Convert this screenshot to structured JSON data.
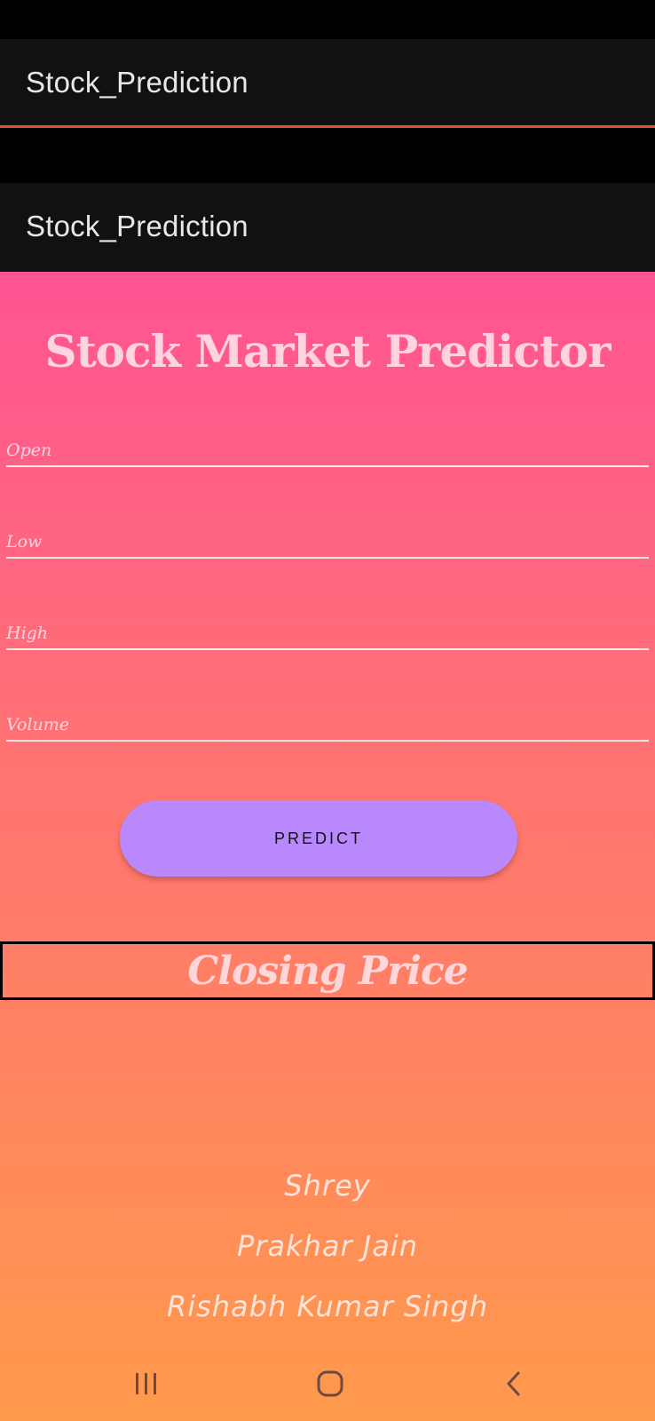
{
  "app_bars": [
    {
      "title": "Stock_Prediction"
    },
    {
      "title": "Stock_Prediction"
    }
  ],
  "main": {
    "headline": "Stock Market Predictor",
    "fields": [
      {
        "name": "open",
        "placeholder": "Open",
        "value": ""
      },
      {
        "name": "low",
        "placeholder": "Low",
        "value": ""
      },
      {
        "name": "high",
        "placeholder": "High",
        "value": ""
      },
      {
        "name": "volume",
        "placeholder": "Volume",
        "value": ""
      }
    ],
    "predict_label": "PREDICT",
    "result_label": "Closing Price",
    "credits": [
      "Shrey",
      "Prakhar Jain",
      "Rishabh Kumar Singh"
    ]
  },
  "nav": {
    "recent": "recent-apps-icon",
    "home": "home-icon",
    "back": "back-icon"
  },
  "colors": {
    "gradient_top": "#ff5494",
    "gradient_bottom": "#ff9a4c",
    "button": "#b988fc",
    "accent_line": "#e2532b",
    "app_bar": "#111113"
  }
}
